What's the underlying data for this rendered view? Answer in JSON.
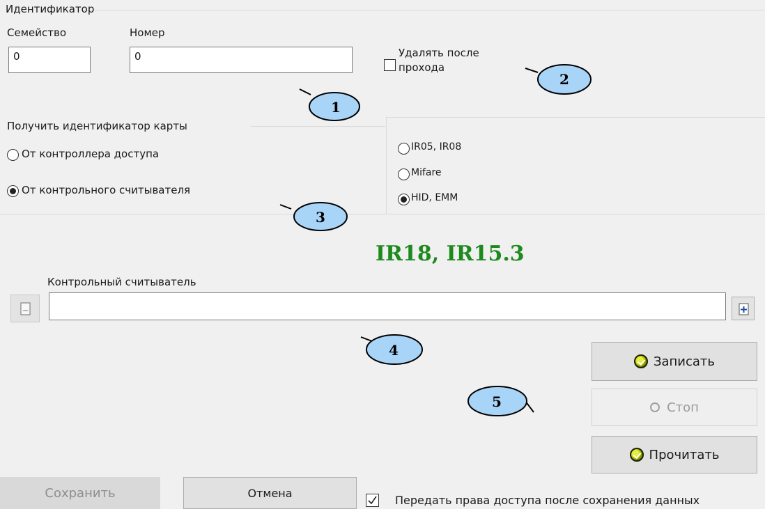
{
  "identifier": {
    "group_title": "Идентификатор",
    "family_label": "Семейство",
    "family_value": "0",
    "number_label": "Номер",
    "number_value": "0",
    "delete_after_pass_label": "Удалять после прохода",
    "delete_after_pass_line1": "Удалять после",
    "delete_after_pass_line2": "прохода",
    "delete_after_pass_checked": false
  },
  "get_card_id": {
    "group_title": "Получить идентификатор карты",
    "options": [
      {
        "label": "От контроллера доступа",
        "selected": false
      },
      {
        "label": "От контрольного считывателя",
        "selected": true
      }
    ]
  },
  "card_type": {
    "options": [
      {
        "label": "IR05, IR08",
        "selected": false
      },
      {
        "label": "Mifare",
        "selected": false
      },
      {
        "label": "HID, EMM",
        "selected": true
      }
    ]
  },
  "reader_model": "IR18, IR15.3",
  "control_reader": {
    "label": "Контрольный считыватель",
    "value": ""
  },
  "actions": {
    "write_label": "Записать",
    "stop_label": "Стоп",
    "read_label": "Прочитать"
  },
  "footer": {
    "save_label": "Сохранить",
    "cancel_label": "Отмена",
    "transfer_rights_label": "Передать права доступа после сохранения данных",
    "transfer_rights_checked": true
  },
  "callouts": [
    "1",
    "2",
    "3",
    "4",
    "5"
  ],
  "colors": {
    "callout_fill": "#a8d4f8",
    "model_text": "#1e8a1e",
    "background": "#f0f0f0"
  }
}
